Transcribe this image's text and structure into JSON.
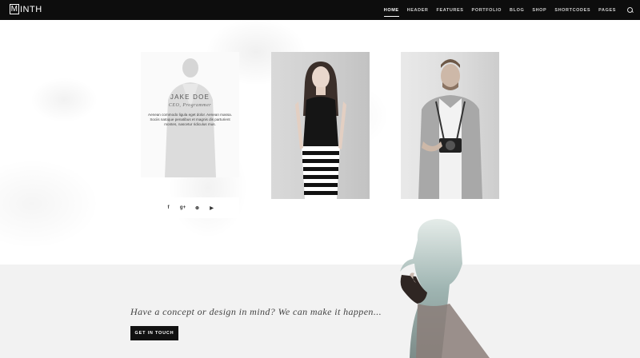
{
  "brand": {
    "logo_letter": "M",
    "logo_rest": "INTH"
  },
  "nav": {
    "items": [
      {
        "label": "HOME",
        "active": true
      },
      {
        "label": "HEADER",
        "active": false
      },
      {
        "label": "FEATURES",
        "active": false
      },
      {
        "label": "PORTFOLIO",
        "active": false
      },
      {
        "label": "BLOG",
        "active": false
      },
      {
        "label": "SHOP",
        "active": false
      },
      {
        "label": "SHORTCODES",
        "active": false
      },
      {
        "label": "PAGES",
        "active": false
      }
    ],
    "search_icon": "search-icon"
  },
  "team": {
    "member": {
      "name": "JAKE DOE",
      "role": "CEO, Programmer",
      "bio": "Aenean commodo ligula eget dolor. Aenean massa. Sociis natoque penatibus et magnis dis parturient montes, nascetur ridiculus mus."
    },
    "social": [
      {
        "icon": "facebook-icon",
        "glyph": "f"
      },
      {
        "icon": "google-plus-icon",
        "glyph": "g+"
      },
      {
        "icon": "dribbble-icon",
        "glyph": "⊛"
      },
      {
        "icon": "youtube-icon",
        "glyph": "▶"
      }
    ]
  },
  "cta": {
    "headline": "Have a concept or design in mind? We can make it happen...",
    "button_label": "GET IN TOUCH"
  },
  "colors": {
    "nav_bg": "#0d0d0d",
    "cta_bg": "#f2f2f2",
    "button_bg": "#111111"
  }
}
